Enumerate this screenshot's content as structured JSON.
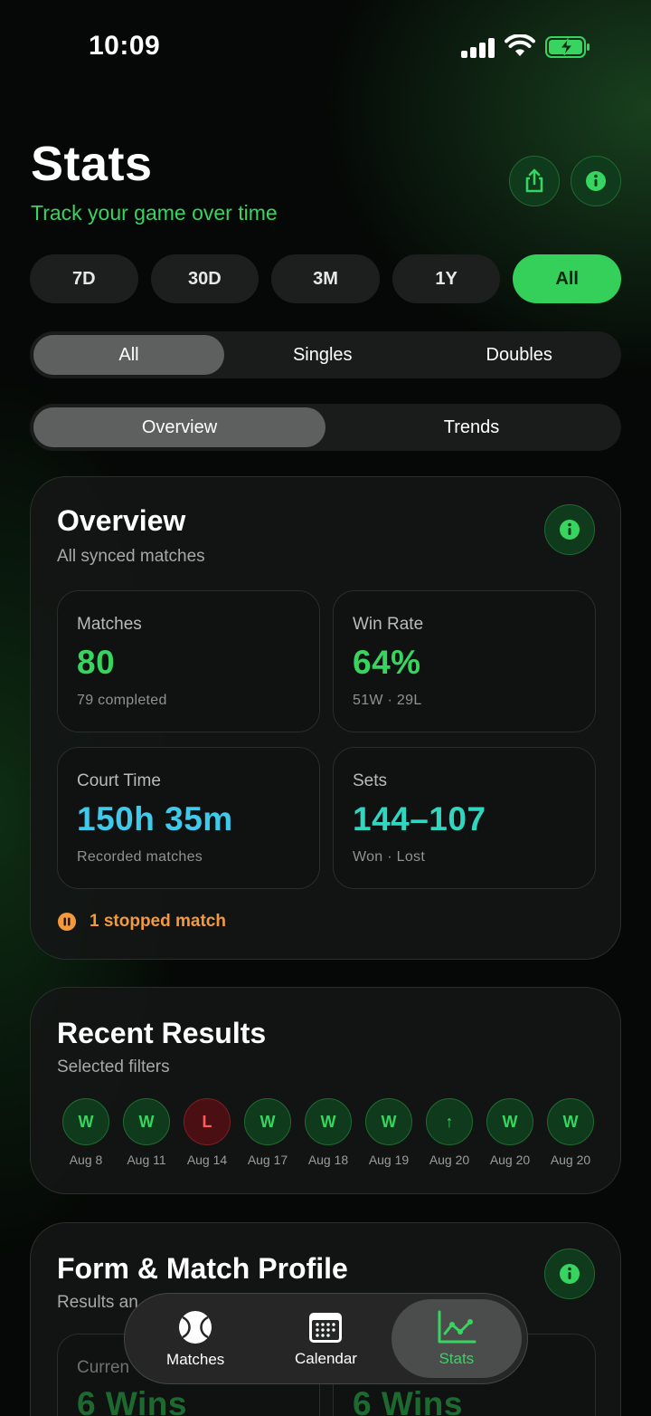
{
  "status_bar": {
    "time": "10:09"
  },
  "header": {
    "title": "Stats",
    "subtitle": "Track your game over time",
    "share_icon": "share-icon",
    "info_icon": "info-icon"
  },
  "ranges": [
    "7D",
    "30D",
    "3M",
    "1Y",
    "All"
  ],
  "selected_range": "All",
  "match_types": [
    "All",
    "Singles",
    "Doubles"
  ],
  "selected_match_type": "All",
  "views": [
    "Overview",
    "Trends"
  ],
  "selected_view": "Overview",
  "overview": {
    "title": "Overview",
    "subtitle": "All synced matches",
    "tiles": [
      {
        "label": "Matches",
        "value": "80",
        "note": "79 completed",
        "color": "#38d460"
      },
      {
        "label": "Win Rate",
        "value": "64%",
        "note": "51W · 29L",
        "color": "#38d460"
      },
      {
        "label": "Court Time",
        "value": "150h 35m",
        "note": "Recorded matches",
        "color": "#3fc9ea"
      },
      {
        "label": "Sets",
        "value": "144–107",
        "note": "Won · Lost",
        "color": "#2fd6c0"
      }
    ],
    "stopped_text": "1 stopped match",
    "stopped_color": "#f59a3c"
  },
  "recent_results": {
    "title": "Recent Results",
    "subtitle": "Selected filters",
    "items": [
      {
        "result": "W",
        "date": "Aug 8"
      },
      {
        "result": "W",
        "date": "Aug 11"
      },
      {
        "result": "L",
        "date": "Aug 14"
      },
      {
        "result": "W",
        "date": "Aug 17"
      },
      {
        "result": "W",
        "date": "Aug 18"
      },
      {
        "result": "W",
        "date": "Aug 19"
      },
      {
        "result": "↑",
        "date": "Aug 20"
      },
      {
        "result": "W",
        "date": "Aug 20"
      },
      {
        "result": "W",
        "date": "Aug 20"
      }
    ]
  },
  "form_profile": {
    "title": "Form & Match Profile",
    "subtitle": "Results an",
    "tile_label": "Curren",
    "value_left": "6 Wins",
    "value_right": "6 Wins"
  },
  "tabbar": {
    "tabs": [
      {
        "label": "Matches",
        "icon": "tennis-ball-icon"
      },
      {
        "label": "Calendar",
        "icon": "calendar-icon"
      },
      {
        "label": "Stats",
        "icon": "chart-icon"
      }
    ],
    "active": "Stats"
  },
  "colors": {
    "accent": "#38d460",
    "loss": "#ff5b5b",
    "background": "#050806"
  }
}
